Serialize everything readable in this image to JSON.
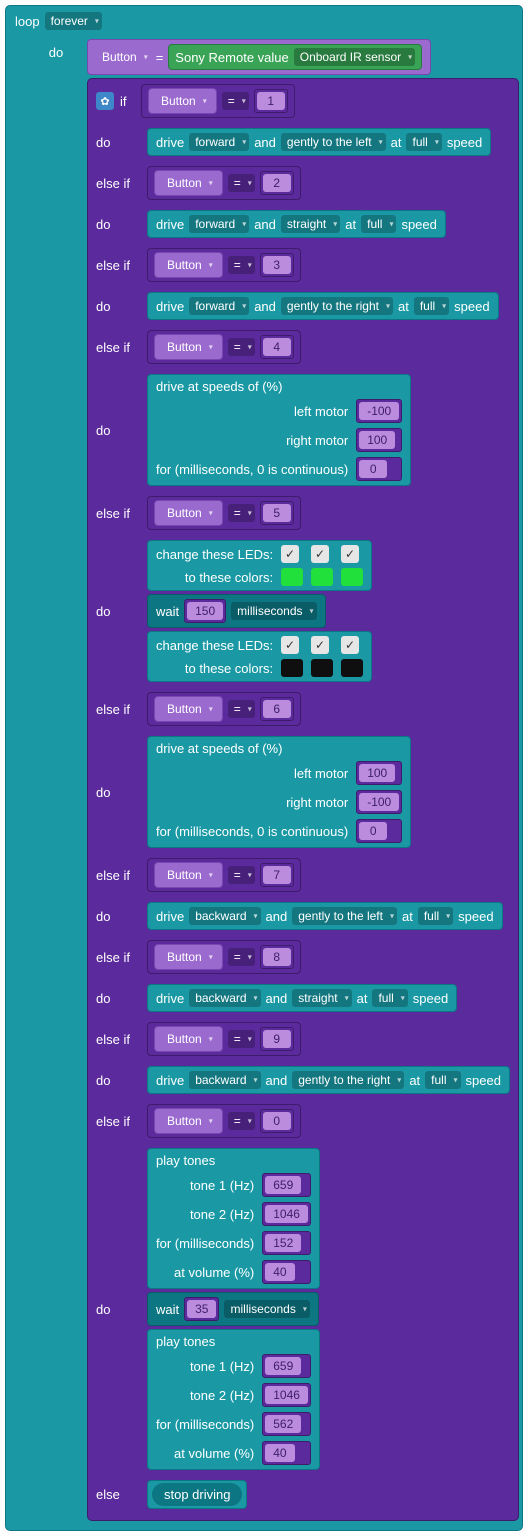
{
  "loop": {
    "label": "loop",
    "mode": "forever"
  },
  "do": "do",
  "set": {
    "var": "Button",
    "eq": "=",
    "src_label": "Sony Remote value",
    "sensor": "Onboard IR sensor"
  },
  "if_kw": "if",
  "else_if": "else if",
  "else": "else",
  "gear": "✿",
  "check": "✓",
  "eq": "=",
  "btn": "Button",
  "drive": {
    "label": "drive",
    "and": "and",
    "at": "at",
    "speed": "speed",
    "forward": "forward",
    "backward": "backward",
    "gleft": "gently to the left",
    "straight": "straight",
    "gright": "gently to the right",
    "full": "full"
  },
  "driveAt": {
    "title": "drive at speeds of (%)",
    "left": "left motor",
    "right": "right motor",
    "dur": "for (milliseconds, 0 is continuous)"
  },
  "cond": {
    "c1": "1",
    "c2": "2",
    "c3": "3",
    "c4": "4",
    "c5": "5",
    "c6": "6",
    "c7": "7",
    "c8": "8",
    "c9": "9",
    "c0": "0"
  },
  "motors4": {
    "l": "-100",
    "r": "100",
    "d": "0"
  },
  "motors6": {
    "l": "100",
    "r": "-100",
    "d": "0"
  },
  "leds": {
    "title": "change these LEDs:",
    "colors": "to these colors:",
    "on": "#22e03b",
    "off": "#0f0f0f"
  },
  "wait": {
    "label": "wait",
    "unit": "milliseconds",
    "v1": "150",
    "v2": "35"
  },
  "tone": {
    "title": "play tones",
    "t1": "tone 1 (Hz)",
    "t2": "tone 2 (Hz)",
    "dur": "for (milliseconds)",
    "vol": "at volume (%)",
    "a": {
      "t1": "659",
      "t2": "1046",
      "d": "152",
      "v": "40"
    },
    "b": {
      "t1": "659",
      "t2": "1046",
      "d": "562",
      "v": "40"
    }
  },
  "stop": "stop driving"
}
